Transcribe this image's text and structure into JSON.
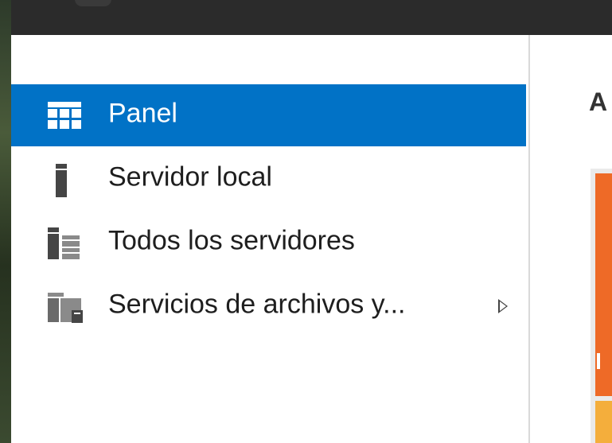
{
  "sidebar": {
    "items": [
      {
        "label": "Panel",
        "icon": "dashboard-icon",
        "selected": true
      },
      {
        "label": "Servidor local",
        "icon": "server-icon",
        "selected": false
      },
      {
        "label": "Todos los servidores",
        "icon": "servers-icon",
        "selected": false
      },
      {
        "label": "Servicios de archivos y...",
        "icon": "file-services-icon",
        "selected": false,
        "has_submenu": true
      }
    ]
  },
  "content": {
    "heading": "A"
  },
  "colors": {
    "selected_bg": "#0172c6",
    "tile_orange": "#ee6a27",
    "tile_yellow": "#f4ae3c",
    "titlebar": "#2b2b2b"
  }
}
